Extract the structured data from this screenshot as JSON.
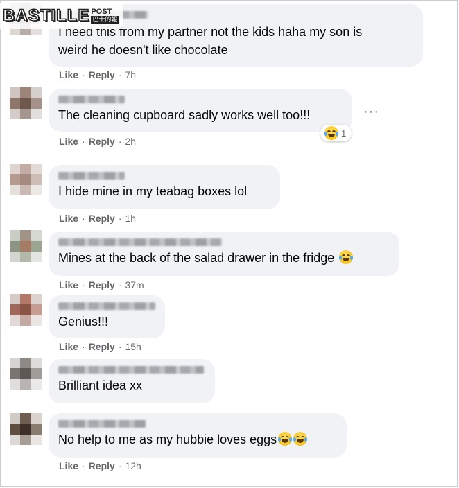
{
  "watermark": {
    "brand": "BASTILLE",
    "sub_top": "POST",
    "sub_bottom": "巴士的報"
  },
  "actions": {
    "like": "Like",
    "reply": "Reply",
    "sep": "·"
  },
  "more_label": "···",
  "comments": [
    {
      "text_lines": [
        "I need this from my partner not the kids haha my son is",
        "weird he doesn't like chocolate"
      ],
      "time": "7h"
    },
    {
      "text_lines": [
        "The cleaning cupboard sadly works well too!!!"
      ],
      "time": "2h",
      "reaction_count": "1"
    },
    {
      "text_lines": [
        "I hide mine in my teabag boxes lol"
      ],
      "time": "1h"
    },
    {
      "text_lines": [
        "Mines at the back of the salad drawer in the fridge"
      ],
      "time": "37m",
      "emoji": "laughing-crying"
    },
    {
      "text_lines": [
        "Genius!!!"
      ],
      "time": "15h"
    },
    {
      "text_lines": [
        "Brilliant idea xx"
      ],
      "time": ""
    },
    {
      "text_lines": [
        "No help to me as my hubbie loves eggs"
      ],
      "time": "12h",
      "emoji": "laughing-crying x2"
    }
  ],
  "colors": {
    "bubble": "#f0f2f5",
    "meta": "#65676b",
    "text": "#050505"
  }
}
